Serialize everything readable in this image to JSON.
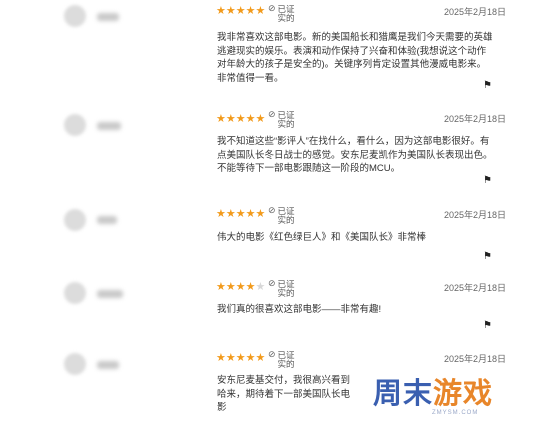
{
  "reviews": [
    {
      "rating": 5,
      "verified_1": "已证",
      "verified_2": "实的",
      "date": "2025年2月18日",
      "text": "我非常喜欢这部电影。新的美国船长和猎鹰是我们今天需要的英雄逃避现实的娱乐。表演和动作保持了兴奋和体验(我想说这个动作对年龄大的孩子是安全的)。关键序列肯定设置其他漫威电影来。非常值得一看。"
    },
    {
      "rating": 5,
      "verified_1": "已证",
      "verified_2": "实的",
      "date": "2025年2月18日",
      "text": "我不知道这些“影评人”在找什么，看什么，因为这部电影很好。有点美国队长冬日战士的感觉。安东尼麦凯作为美国队长表现出色。不能等待下一部电影跟随这一阶段的MCU。"
    },
    {
      "rating": 5,
      "verified_1": "已证",
      "verified_2": "实的",
      "date": "2025年2月18日",
      "text": "伟大的电影《红色绿巨人》和《美国队长》非常棒"
    },
    {
      "rating": 4,
      "verified_1": "已证",
      "verified_2": "实的",
      "date": "2025年2月18日",
      "text": "我们真的很喜欢这部电影——非常有趣!"
    },
    {
      "rating": 5,
      "verified_1": "已证",
      "verified_2": "实的",
      "date": "2025年2月18日",
      "text": "安东尼麦基交付，我很高兴看到哈来，期待着下一部美国队长电影"
    }
  ],
  "icons": {
    "verified": "check-circle-icon",
    "report": "flag-icon",
    "star_color": "#f29a1b"
  },
  "watermark": {
    "brand_part1": "周末",
    "brand_part2": "游戏",
    "url": "ZMYSM.COM"
  }
}
